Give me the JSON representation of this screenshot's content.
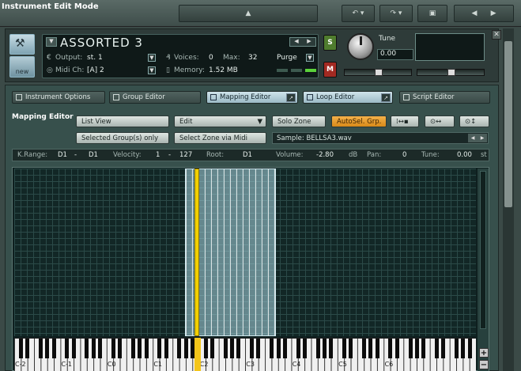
{
  "window": {
    "title": "Instrument Edit Mode"
  },
  "instrument": {
    "name": "ASSORTED 3",
    "output_label": "Output:",
    "output_value": "st. 1",
    "midi_label": "Midi Ch:",
    "midi_value": "[A]  2",
    "voices_label": "Voices:",
    "voices_value": "0",
    "max_label": "Max:",
    "max_value": "32",
    "memory_label": "Memory:",
    "memory_value": "1.52 MB",
    "purge_label": "Purge",
    "new_label": "new",
    "solo_label": "S",
    "mute_label": "M",
    "tune_label": "Tune",
    "tune_value": "0.00"
  },
  "tabs": [
    {
      "label": "Instrument Options",
      "active": false
    },
    {
      "label": "Group Editor",
      "active": false
    },
    {
      "label": "Mapping Editor",
      "active": true
    },
    {
      "label": "Loop Editor",
      "active": true
    },
    {
      "label": "Script Editor",
      "active": false
    }
  ],
  "mapping": {
    "title": "Mapping Editor",
    "list_view": "List View",
    "edit": "Edit",
    "solo_zone": "Solo Zone",
    "autosel": "AutoSel. Grp.",
    "selected_groups": "Selected Group(s) only",
    "select_zone_midi": "Select Zone via Midi",
    "sample_label": "Sample:",
    "sample_value": "BELLSA3.wav"
  },
  "infobar": {
    "krange_label": "K.Range:",
    "krange_lo": "D1",
    "krange_dash": "-",
    "krange_hi": "D1",
    "vel_label": "Velocity:",
    "vel_lo": "1",
    "vel_dash": "-",
    "vel_hi": "127",
    "root_label": "Root:",
    "root_value": "D1",
    "volume_label": "Volume:",
    "volume_value": "-2.80",
    "volume_unit": "dB",
    "pan_label": "Pan:",
    "pan_value": "0",
    "tune_label": "Tune:",
    "tune_value": "0.00",
    "tune_unit": "st"
  },
  "keyboard": {
    "octave_labels": [
      "C-2",
      "C-1",
      "C0",
      "C1",
      "C2",
      "C3",
      "C4",
      "C5",
      "C6"
    ]
  },
  "colors": {
    "accent": "#f4b04a",
    "zone": "#aad7e1",
    "selected_key": "#f2d000",
    "solo": "#4f7c2e",
    "mute": "#a32a22"
  }
}
